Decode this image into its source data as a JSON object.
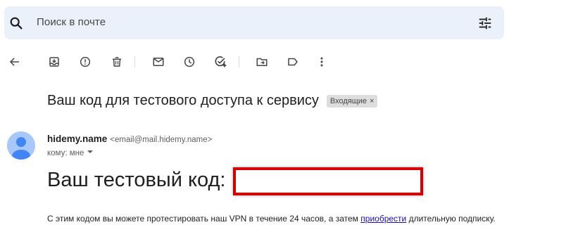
{
  "search": {
    "placeholder": "Поиск в почте",
    "icon": "search-icon",
    "options_icon": "tune-icon"
  },
  "toolbar": {
    "back_icon": "arrow-back-icon",
    "buttons": [
      "archive-icon",
      "report-spam-icon",
      "delete-icon",
      "mark-unread-icon",
      "snooze-icon",
      "add-task-icon",
      "move-to-icon",
      "label-icon",
      "more-vert-icon"
    ]
  },
  "email": {
    "subject": "Ваш код для тестового доступа к сервису",
    "label_chip": "Входящие",
    "label_close": "×",
    "sender_name": "hidemy.name",
    "sender_email": "<email@mail.hidemy.name>",
    "recipient": "кому: мне",
    "code_label": "Ваш тестовый код:",
    "body_before_link": "С этим кодом вы можете протестировать наш VPN в течение 24 часов, а затем ",
    "body_link": "приобрести",
    "body_after_link": " длительную подписку."
  },
  "colors": {
    "search_bg": "#eaf1fb",
    "redaction_border": "#d40000",
    "link": "#1a0dab",
    "avatar_bg": "#a8c7fa",
    "avatar_fg": "#4285f4"
  }
}
